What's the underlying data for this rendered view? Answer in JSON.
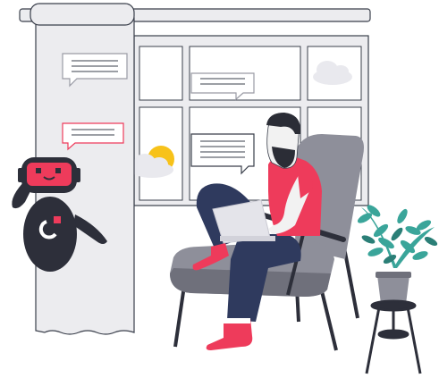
{
  "illustration": {
    "elements": [
      "curtain",
      "window",
      "chat-bubbles",
      "robot",
      "person",
      "armchair",
      "laptop",
      "potted-plant",
      "plant-stand"
    ]
  },
  "colors": {
    "outline": "#3a3f4b",
    "curtain_fill": "#ececef",
    "window_frame": "#ffffff",
    "cloud": "#e9e9ee",
    "sun": "#f7c21a",
    "accent_red": "#ee3b5b",
    "robot_body": "#2d2f3a",
    "chair": "#8e8f9a",
    "chair_dark": "#6f707b",
    "jeans": "#2f3a5e",
    "skin": "#f2f2f2",
    "hair": "#2b2d36",
    "laptop": "#e4e4ea",
    "plant_leaf": "#3aa59a",
    "plant_leaf_dark": "#2b7f77",
    "pot": "#8e8f9a"
  },
  "icons": [
    "chat-bubble-icon",
    "robot-logo-icon",
    "sun-icon",
    "cloud-icon"
  ]
}
